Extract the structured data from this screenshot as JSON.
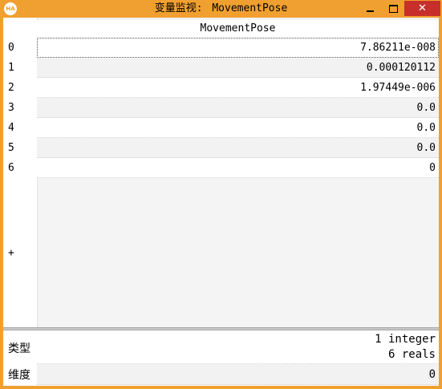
{
  "window": {
    "icon_text": "HA",
    "title_prefix": "变量监视:",
    "title_name": "MovementPose"
  },
  "table": {
    "column_header": "MovementPose",
    "rows": [
      {
        "index": "0",
        "value": "7.86211e-008"
      },
      {
        "index": "1",
        "value": "0.000120112"
      },
      {
        "index": "2",
        "value": "1.97449e-006"
      },
      {
        "index": "3",
        "value": "0.0"
      },
      {
        "index": "4",
        "value": "0.0"
      },
      {
        "index": "5",
        "value": "0.0"
      },
      {
        "index": "6",
        "value": "0"
      }
    ],
    "add_row_label": "+"
  },
  "properties": {
    "type_label": "类型",
    "type_line1": "1 integer",
    "type_line2": "6 reals",
    "dimension_label": "维度",
    "dimension_value": "0"
  }
}
